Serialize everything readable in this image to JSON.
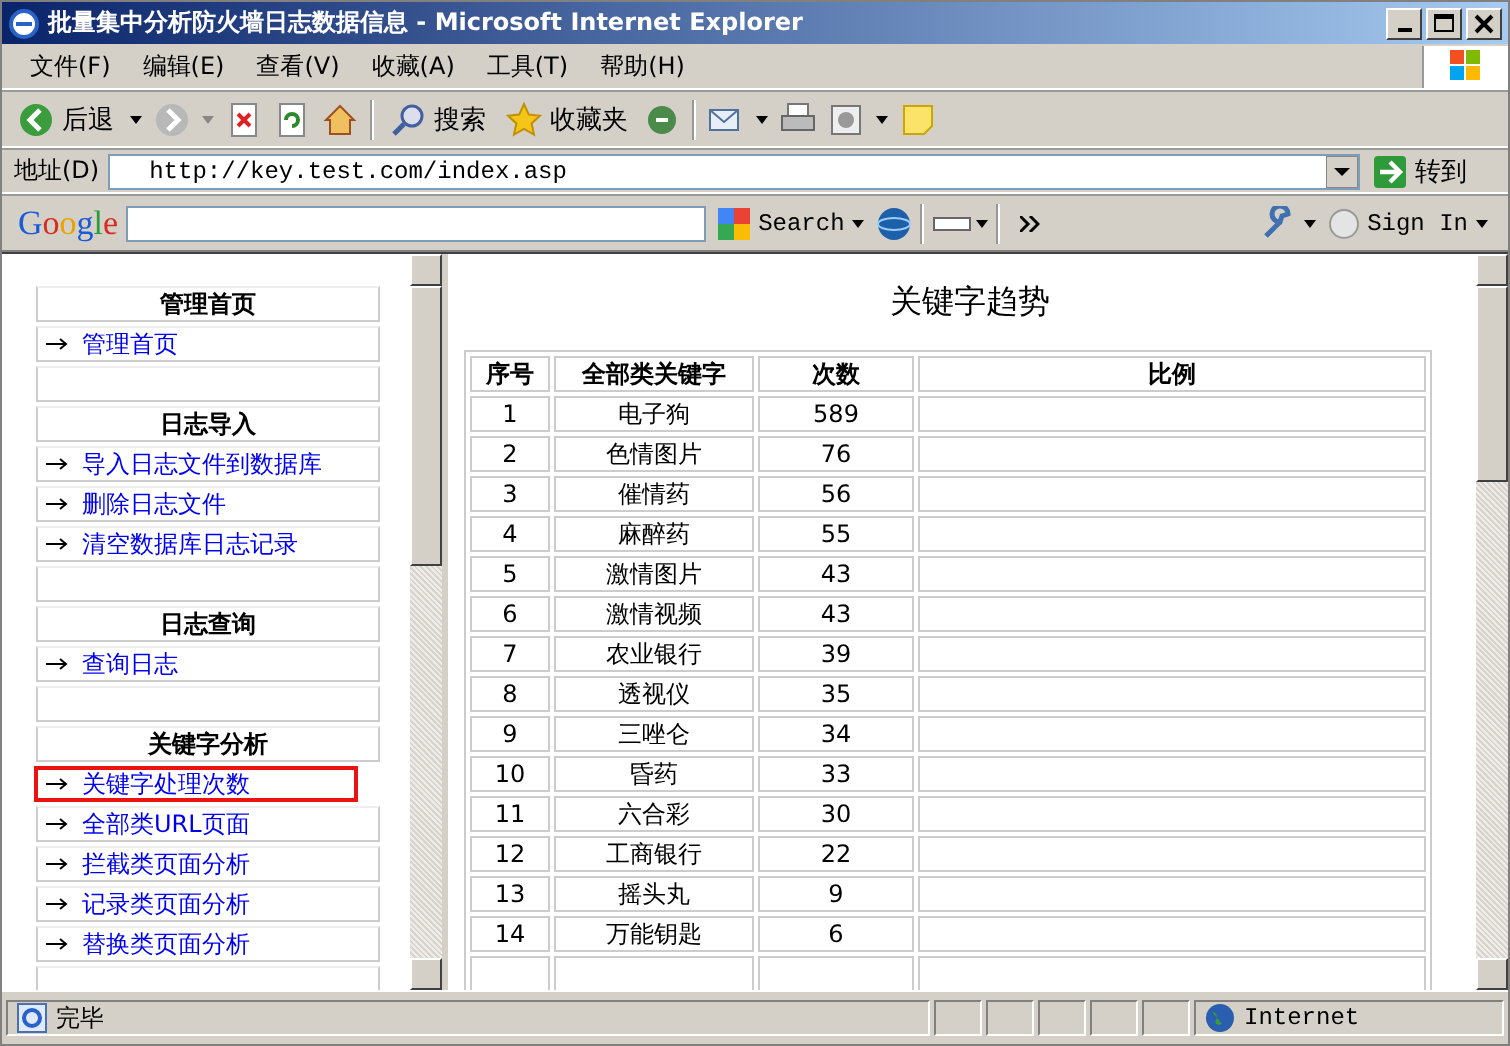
{
  "window": {
    "title": "批量集中分析防火墙日志数据信息 - Microsoft Internet Explorer"
  },
  "menu": [
    "文件(F)",
    "编辑(E)",
    "查看(V)",
    "收藏(A)",
    "工具(T)",
    "帮助(H)"
  ],
  "toolbar": {
    "back": "后退",
    "search": "搜索",
    "favorites": "收藏夹"
  },
  "address": {
    "label": "地址(D)",
    "url": "http://key.test.com/index.asp",
    "go": "转到"
  },
  "google_bar": {
    "logo": "Google",
    "search": "Search",
    "sign_in": "Sign In"
  },
  "sidebar": {
    "sections": [
      {
        "title": "管理首页",
        "links": [
          {
            "label": "管理首页",
            "selected": false
          }
        ]
      },
      {
        "title": "日志导入",
        "links": [
          {
            "label": "导入日志文件到数据库",
            "selected": false
          },
          {
            "label": "删除日志文件",
            "selected": false
          },
          {
            "label": "清空数据库日志记录",
            "selected": false
          }
        ]
      },
      {
        "title": "日志查询",
        "links": [
          {
            "label": "查询日志",
            "selected": false
          }
        ]
      },
      {
        "title": "关键字分析",
        "links": [
          {
            "label": "关键字处理次数",
            "selected": true
          },
          {
            "label": "全部类URL页面",
            "selected": false
          },
          {
            "label": "拦截类页面分析",
            "selected": false
          },
          {
            "label": "记录类页面分析",
            "selected": false
          },
          {
            "label": "替换类页面分析",
            "selected": false
          }
        ]
      }
    ]
  },
  "main": {
    "heading": "关键字趋势",
    "table": {
      "columns": [
        "序号",
        "全部类关键字",
        "次数",
        "比例"
      ],
      "rows": [
        [
          "1",
          "电子狗",
          "589"
        ],
        [
          "2",
          "色情图片",
          "76"
        ],
        [
          "3",
          "催情药",
          "56"
        ],
        [
          "4",
          "麻醉药",
          "55"
        ],
        [
          "5",
          "激情图片",
          "43"
        ],
        [
          "6",
          "激情视频",
          "43"
        ],
        [
          "7",
          "农业银行",
          "39"
        ],
        [
          "8",
          "透视仪",
          "35"
        ],
        [
          "9",
          "三唑仑",
          "34"
        ],
        [
          "10",
          "昏药",
          "33"
        ],
        [
          "11",
          "六合彩",
          "30"
        ],
        [
          "12",
          "工商银行",
          "22"
        ],
        [
          "13",
          "摇头丸",
          "9"
        ],
        [
          "14",
          "万能钥匙",
          "6"
        ]
      ]
    }
  },
  "status_bar": {
    "text": "完毕",
    "zone": "Internet"
  }
}
